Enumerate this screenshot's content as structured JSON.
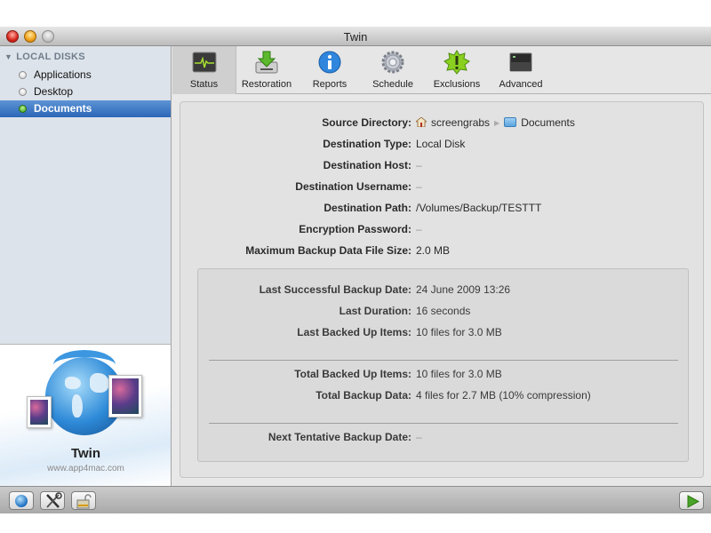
{
  "window": {
    "title": "Twin"
  },
  "sidebar": {
    "section_label": "LOCAL DISKS",
    "items": [
      {
        "label": "Applications",
        "selected": false
      },
      {
        "label": "Desktop",
        "selected": false
      },
      {
        "label": "Documents",
        "selected": true
      }
    ]
  },
  "promo": {
    "app_name": "Twin",
    "url": "www.app4mac.com"
  },
  "toolbar": {
    "tabs": [
      {
        "label": "Status",
        "icon": "status-monitor-icon",
        "selected": true
      },
      {
        "label": "Restoration",
        "icon": "restore-disk-icon",
        "selected": false
      },
      {
        "label": "Reports",
        "icon": "info-icon",
        "selected": false
      },
      {
        "label": "Schedule",
        "icon": "gear-icon",
        "selected": false
      },
      {
        "label": "Exclusions",
        "icon": "exclamation-badge-icon",
        "selected": false
      },
      {
        "label": "Advanced",
        "icon": "terminal-icon",
        "selected": false
      }
    ]
  },
  "details": {
    "source_directory": {
      "label": "Source Directory:",
      "home": "screengrabs",
      "folder": "Documents"
    },
    "rows": [
      {
        "label": "Destination Type:",
        "value": "Local Disk"
      },
      {
        "label": "Destination Host:",
        "value": "–"
      },
      {
        "label": "Destination Username:",
        "value": "–"
      },
      {
        "label": "Destination Path:",
        "value": "/Volumes/Backup/TESTTT"
      },
      {
        "label": "Encryption Password:",
        "value": "–"
      },
      {
        "label": "Maximum Backup Data File Size:",
        "value": "2.0 MB"
      }
    ]
  },
  "summary": {
    "last": [
      {
        "label": "Last Successful Backup Date:",
        "value": "24 June 2009 13:26"
      },
      {
        "label": "Last Duration:",
        "value": "16 seconds"
      },
      {
        "label": "Last Backed Up Items:",
        "value": "10 files for 3.0 MB"
      }
    ],
    "totals": [
      {
        "label": "Total Backed Up Items:",
        "value": "10 files for 3.0 MB"
      },
      {
        "label": "Total Backup Data:",
        "value": "4 files for 2.7 MB (10% compression)"
      }
    ],
    "next": {
      "label": "Next Tentative Backup Date:",
      "value": "–"
    }
  },
  "bottombar": {
    "buttons": [
      "web-globe-icon",
      "tools-icon",
      "lock-icon"
    ],
    "start_button": "play-icon"
  }
}
